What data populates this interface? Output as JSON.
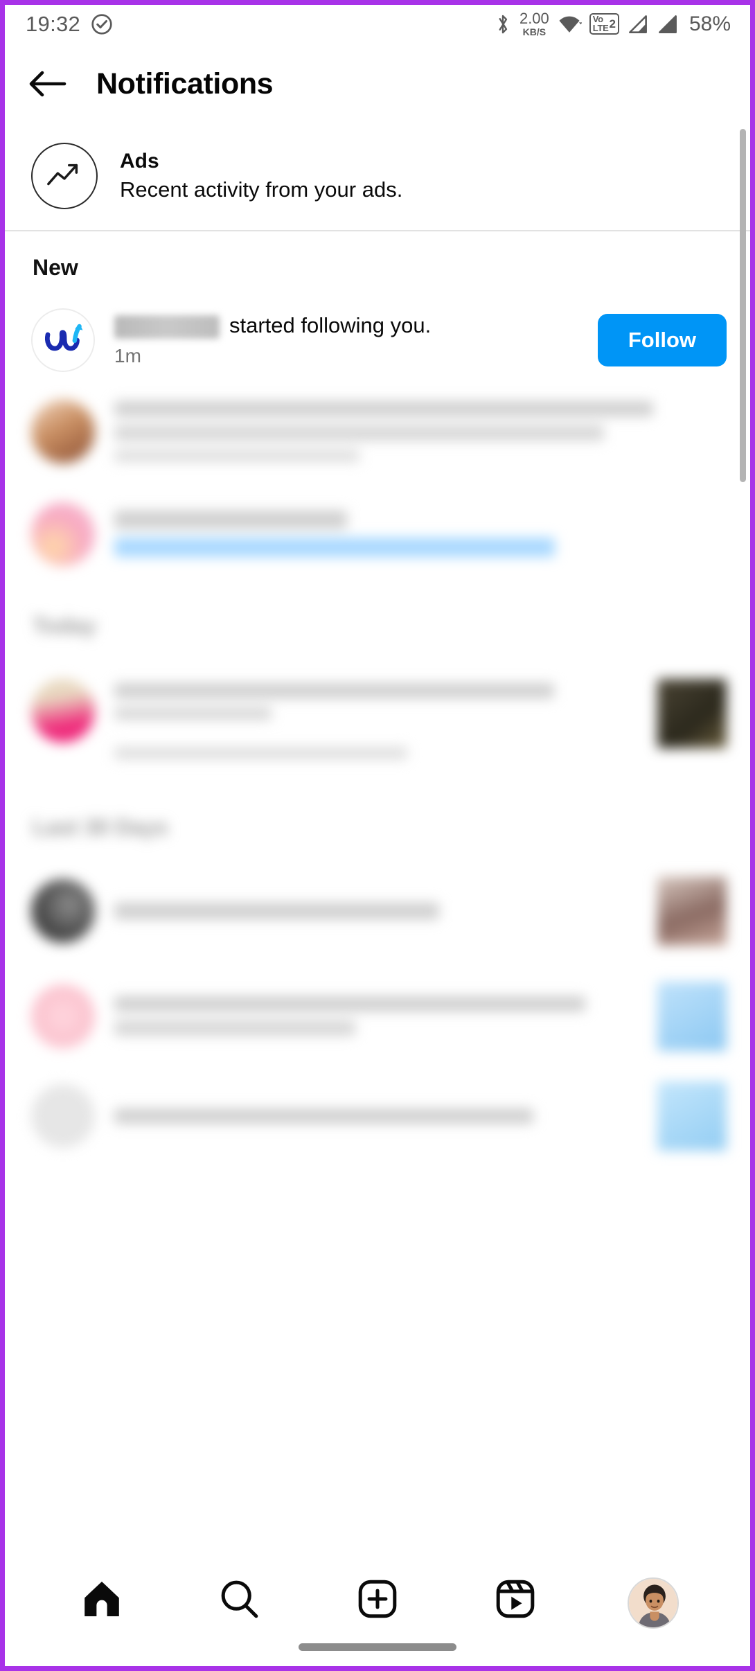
{
  "status_bar": {
    "time": "19:32",
    "check_icon": "check-circle-icon",
    "bluetooth_icon": "bluetooth-icon",
    "data_speed_value": "2.00",
    "data_speed_unit": "KB/S",
    "wifi_icon": "wifi-icon",
    "volte_label_top": "Vo",
    "volte_label_bottom": "LTE",
    "volte_sim": "2",
    "signal_1_icon": "signal-bars-icon",
    "signal_2_icon": "signal-bars-icon",
    "battery": "58%"
  },
  "header": {
    "back_icon": "arrow-left-icon",
    "title": "Notifications"
  },
  "ads": {
    "icon": "trending-up-icon",
    "title": "Ads",
    "subtitle": "Recent activity from your ads."
  },
  "sections": [
    {
      "label": "New",
      "blurred": false
    },
    {
      "label": "Today",
      "blurred": true
    },
    {
      "label": "Last 30 Days",
      "blurred": true
    }
  ],
  "new_notification": {
    "username_redacted": "",
    "message": "started following you.",
    "timestamp": "1m",
    "follow_label": "Follow",
    "avatar": "brand-logo-avatar",
    "accent_color": "#0095f6"
  },
  "blurred_rows": [
    {
      "avatar_color": "#d8a27a",
      "lines": 3,
      "has_thumb": false,
      "link": false
    },
    {
      "avatar_color": "#f7c6d2",
      "lines": 2,
      "has_thumb": false,
      "link": true
    },
    {
      "avatar_color": "#ef2a7b",
      "lines": 3,
      "has_thumb": true,
      "thumb_color": "#3a3428"
    },
    {
      "avatar_color": "#565656",
      "lines": 1,
      "has_thumb": true,
      "thumb_color": "#b8a0a0"
    },
    {
      "avatar_color": "#f6c9d1",
      "lines": 2,
      "has_thumb": true,
      "thumb_color": "#a9d4f5"
    },
    {
      "avatar_color": "#dedede",
      "lines": 1,
      "has_thumb": true,
      "thumb_color": "#a9d4f5"
    }
  ],
  "bottom_nav": [
    {
      "name": "home",
      "icon": "home-icon",
      "active": true
    },
    {
      "name": "search",
      "icon": "search-icon",
      "active": false
    },
    {
      "name": "create",
      "icon": "plus-square-icon",
      "active": false
    },
    {
      "name": "reels",
      "icon": "reels-icon",
      "active": false
    },
    {
      "name": "profile",
      "icon": "profile-avatar-icon",
      "active": false,
      "badge": true
    }
  ],
  "colors": {
    "device_border": "#a832e8",
    "instagram_blue": "#0095f6",
    "badge_red": "#e8203a"
  }
}
